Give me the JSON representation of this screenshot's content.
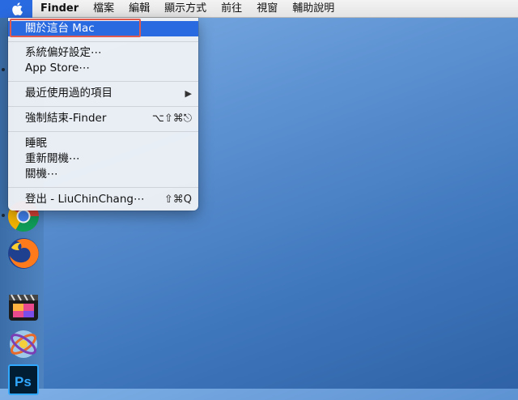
{
  "menubar": {
    "app_name": "Finder",
    "items": [
      "檔案",
      "編輯",
      "顯示方式",
      "前往",
      "視窗",
      "輔助說明"
    ]
  },
  "apple_menu": {
    "items": [
      {
        "label": "關於這台 Mac",
        "shortcut": ""
      },
      {
        "label": "系統偏好設定⋯",
        "shortcut": ""
      },
      {
        "label": "App Store⋯",
        "shortcut": ""
      },
      {
        "label": "最近使用過的項目",
        "shortcut": "▶"
      },
      {
        "label": "強制結束-Finder",
        "shortcut": "⌥⇧⌘⎋"
      },
      {
        "label": "睡眠",
        "shortcut": ""
      },
      {
        "label": "重新開機⋯",
        "shortcut": ""
      },
      {
        "label": "關機⋯",
        "shortcut": ""
      },
      {
        "label": "登出 - LiuChinChang⋯",
        "shortcut": "⇧⌘Q"
      }
    ]
  },
  "colors": {
    "highlight": "#2a6ae0",
    "annotation_border": "#e05a4e"
  },
  "dock_apps": [
    "chrome-icon",
    "firefox-icon",
    "final-cut-pro-icon",
    "motion-icon",
    "photoshop-icon"
  ],
  "photoshop_label": "Ps"
}
